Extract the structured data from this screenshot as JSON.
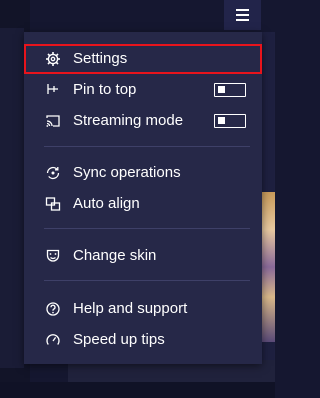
{
  "menu": {
    "items": [
      {
        "label": "Settings",
        "icon": "gear-icon"
      },
      {
        "label": "Pin to top",
        "icon": "pin-icon",
        "toggle": false
      },
      {
        "label": "Streaming mode",
        "icon": "cast-icon",
        "toggle": false
      },
      {
        "label": "Sync operations",
        "icon": "sync-icon"
      },
      {
        "label": "Auto align",
        "icon": "align-icon"
      },
      {
        "label": "Change skin",
        "icon": "skin-icon"
      },
      {
        "label": "Help and support",
        "icon": "help-icon"
      },
      {
        "label": "Speed up tips",
        "icon": "speedometer-icon"
      }
    ],
    "highlighted_item": "Settings"
  },
  "colors": {
    "menu_background": "#262848",
    "highlight_border": "#e8141c",
    "text": "#ffffff",
    "divider": "#3e4068"
  }
}
